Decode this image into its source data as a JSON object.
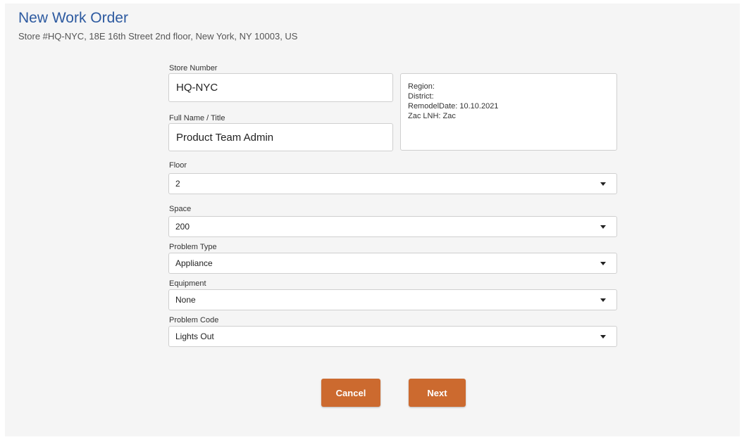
{
  "header": {
    "title": "New Work Order",
    "subtitle": "Store #HQ-NYC, 18E 16th Street 2nd floor, New York, NY 10003, US"
  },
  "form": {
    "store_number": {
      "label": "Store Number",
      "value": "HQ-NYC"
    },
    "full_name": {
      "label": "Full Name / Title",
      "value": "Product Team Admin"
    },
    "info": {
      "region": "Region:",
      "district": "District:",
      "remodel_date": "RemodelDate: 10.10.2021",
      "zac_lnh": "Zac LNH: Zac"
    },
    "floor": {
      "label": "Floor",
      "value": "2"
    },
    "space": {
      "label": "Space",
      "value": "200"
    },
    "problem_type": {
      "label": "Problem Type",
      "value": "Appliance"
    },
    "equipment": {
      "label": "Equipment",
      "value": "None"
    },
    "problem_code": {
      "label": "Problem Code",
      "value": "Lights Out"
    }
  },
  "actions": {
    "cancel_label": "Cancel",
    "next_label": "Next"
  },
  "colors": {
    "title": "#2d5aa0",
    "button": "#cc6a2f",
    "background": "#f5f5f5"
  },
  "icons": {
    "dropdown": "chevron-down-icon"
  }
}
